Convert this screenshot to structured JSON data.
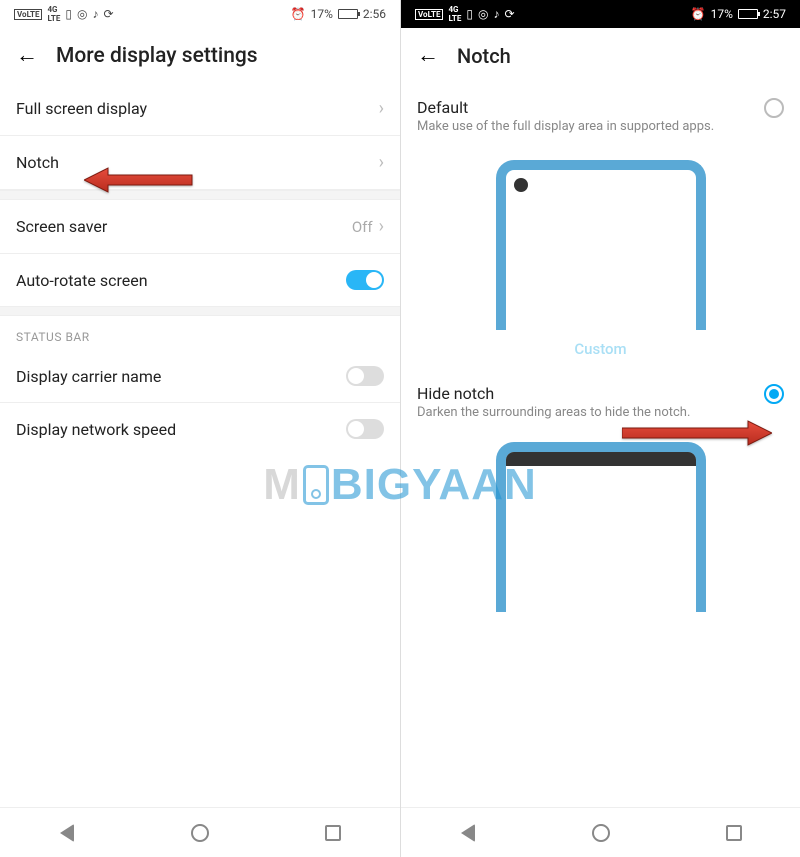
{
  "left": {
    "status": {
      "battery_pct": "17%",
      "time": "2:56"
    },
    "header": {
      "title": "More display settings"
    },
    "items": {
      "full_screen": "Full screen display",
      "notch": "Notch",
      "screen_saver": "Screen saver",
      "screen_saver_value": "Off",
      "auto_rotate": "Auto-rotate screen"
    },
    "section_status_bar": "STATUS BAR",
    "status_bar_items": {
      "carrier": "Display carrier name",
      "net_speed": "Display network speed"
    }
  },
  "right": {
    "status": {
      "battery_pct": "17%",
      "time": "2:57"
    },
    "header": {
      "title": "Notch"
    },
    "default": {
      "title": "Default",
      "desc": "Make use of the full display area in supported apps."
    },
    "custom_label": "Custom",
    "hide": {
      "title": "Hide notch",
      "desc": "Darken the surrounding areas to hide the notch."
    }
  },
  "watermark": {
    "pre": "M",
    "mid": "BIGYAAN"
  }
}
